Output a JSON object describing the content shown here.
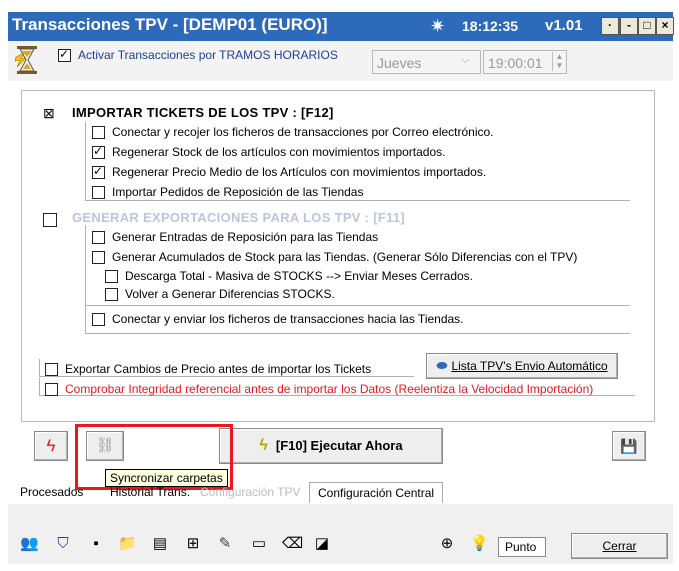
{
  "window": {
    "title": "Transacciones TPV - [DEMP01 (EURO)]",
    "time": "18:12:35",
    "version": "v1.01",
    "controls": {
      "minimize": "-",
      "maximize": "□",
      "close": "×",
      "menu": "·"
    }
  },
  "schedule": {
    "activate_label": "Activar Transacciones por TRAMOS HORARIOS",
    "activate_checked": true,
    "day_value": "Jueves",
    "time_value": "19:00:01"
  },
  "import_section": {
    "header": "IMPORTAR TICKETS DE LOS TPV : [F12]",
    "header_checked": true,
    "items": [
      {
        "label": "Conectar y recojer los ficheros de transacciones por Correo electrónico.",
        "checked": false
      },
      {
        "label": "Regenerar Stock de los artículos con movimientos importados.",
        "checked": true
      },
      {
        "label": "Regenerar Precio Medio de los Artículos con movimientos importados.",
        "checked": true
      },
      {
        "label": "Importar Pedidos de Reposición de las Tiendas",
        "checked": false
      }
    ]
  },
  "export_section": {
    "header": "GENERAR  EXPORTACIONES PARA LOS TPV : [F11]",
    "header_checked": false,
    "items": [
      {
        "label": "Generar Entradas de Reposición para las Tiendas",
        "checked": false
      },
      {
        "label": "Generar Acumulados de Stock para las Tiendas. (Generar Sólo Diferencias con el TPV)",
        "checked": false
      }
    ],
    "sub_items": [
      {
        "label": "Descarga Total - Masiva de STOCKS --> Enviar Meses Cerrados.",
        "checked": false
      },
      {
        "label": "Volver a Generar Diferencias STOCKS.",
        "checked": false
      }
    ],
    "send_item": {
      "label": "Conectar y enviar los ficheros de transacciones hacia las Tiendas.",
      "checked": false
    }
  },
  "options": {
    "price_changes": {
      "label": "Exportar Cambios de Precio antes de importar los Tickets",
      "checked": false
    },
    "auto_send_button": "Lista TPV's Envio Automático",
    "integrity": {
      "label": "Comprobar Integridad referencial antes de importar los Datos  (Reelentiza la Velocidad Importación)",
      "checked": false,
      "color": "#e8191c"
    }
  },
  "actions": {
    "execute_button": "[F10] Ejecutar Ahora",
    "tooltip": "Syncronizar carpetas",
    "highlight_color": "#e8191c"
  },
  "tabs": [
    {
      "label": "Procesados"
    },
    {
      "label": "Historial Trans."
    },
    {
      "label": "Configuración TPV"
    },
    {
      "label": "Configuración Central"
    }
  ],
  "bottom": {
    "separator_value": "Punto",
    "close_button": "Cerrar"
  }
}
